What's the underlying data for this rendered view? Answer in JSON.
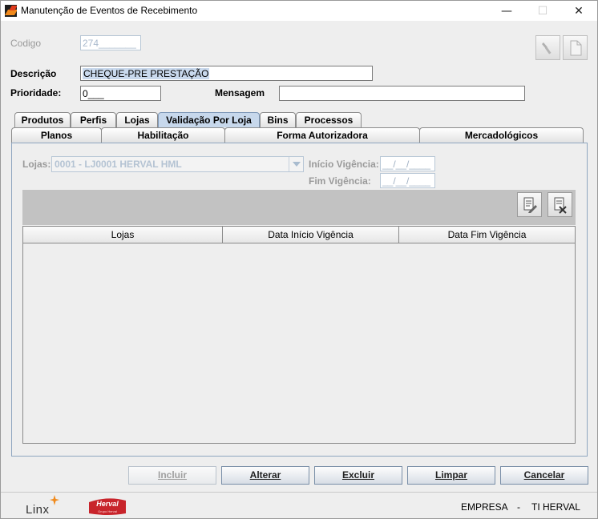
{
  "window": {
    "title": "Manutenção de Eventos de Recebimento",
    "minimize": "—",
    "maximize": "☐",
    "close": "✕"
  },
  "form": {
    "codigo_label": "Codigo",
    "codigo_value": "274_______",
    "descricao_label": "Descrição",
    "descricao_value": "CHEQUE-PRE PRESTAÇÃO",
    "prioridade_label": "Prioridade:",
    "prioridade_value": "0",
    "prioridade_mask": "___",
    "mensagem_label": "Mensagem",
    "mensagem_value": ""
  },
  "tabs_row1": [
    {
      "label": "Produtos"
    },
    {
      "label": "Perfis"
    },
    {
      "label": "Lojas"
    },
    {
      "label": "Validação Por Loja",
      "active": true
    },
    {
      "label": "Bins"
    },
    {
      "label": "Processos"
    }
  ],
  "tabs_row2": [
    {
      "label": "Planos"
    },
    {
      "label": "Habilitação"
    },
    {
      "label": "Forma Autorizadora"
    },
    {
      "label": "Mercadológicos"
    }
  ],
  "panel": {
    "lojas_label": "Lojas:",
    "lojas_value": "0001 - LJ0001 HERVAL HML",
    "inicio_label": "Início Vigência:",
    "inicio_value": "__/__/____",
    "fim_label": "Fim Vigência:",
    "fim_value": "__/__/____"
  },
  "grid": {
    "columns": [
      "Lojas",
      "Data Início Vigência",
      "Data Fim Vigência"
    ],
    "rows": []
  },
  "buttons": {
    "incluir": "Incluir",
    "alterar": "Alterar",
    "excluir": "Excluir",
    "limpar": "Limpar",
    "cancelar": "Cancelar"
  },
  "status": {
    "logo_linx": "Linx",
    "logo_herval": "Herval",
    "logo_herval_sub": "Grupo Herval",
    "empresa_label": "EMPRESA",
    "separator": "-",
    "empresa_value": "TI HERVAL"
  },
  "colors": {
    "active_tab": "#c7d8ec",
    "herval_red": "#c8242b",
    "linx_orange": "#f08a1c"
  }
}
